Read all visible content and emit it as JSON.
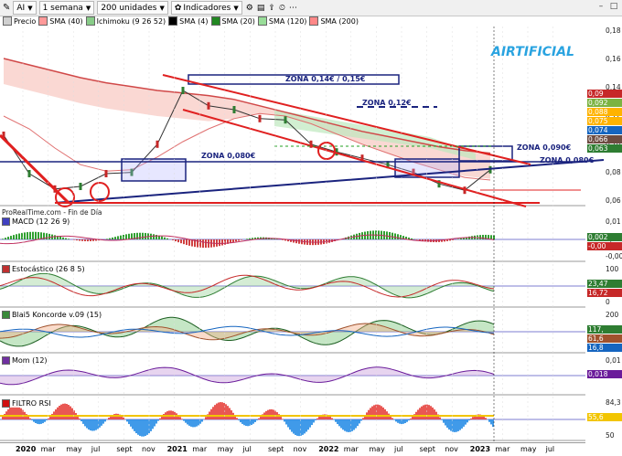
{
  "toolbar": {
    "symbol": "AI",
    "period": "1 semana",
    "units": "200 unidades",
    "indicators": "Indicadores"
  },
  "legend": [
    {
      "label": "Precio",
      "color": "#d0d0d0"
    },
    {
      "label": "SMA (40)",
      "color": "#ff9999"
    },
    {
      "label": "Ichimoku (9 26 52)",
      "color": "#88cc88"
    },
    {
      "label": "SMA (4)",
      "color": "#000000"
    },
    {
      "label": "SMA (20)",
      "color": "#228822"
    },
    {
      "label": "SMA (120)",
      "color": "#99dd99"
    },
    {
      "label": "SMA (200)",
      "color": "#ff8888"
    }
  ],
  "watermark": "AIRTIFICIAL",
  "source_note": "ProRealTime.com - Fin de Día",
  "annotations": {
    "zona_014": "ZONA 0,14€ / 0,15€",
    "zona_012": "ZONA 0,12€",
    "zona_0080_left": "ZONA 0,080€",
    "zona_0090": "ZONA 0,090€",
    "zona_0080_right": "ZONA 0,080€"
  },
  "price_axis": {
    "ticks": [
      "0,18",
      "0,16",
      "0,14",
      "0,12",
      "0,10",
      "0,08",
      "0,06"
    ],
    "labels": [
      "0,09",
      "0,092",
      "0,088",
      "0,075",
      "0,074",
      "0,066",
      "0,063"
    ]
  },
  "panes": {
    "macd": {
      "label": "MACD (12 26 9)",
      "ticks": [
        "0,01",
        "0,00",
        "-0,00"
      ],
      "labels": [
        "0,002",
        "-0,00"
      ]
    },
    "stoch": {
      "label": "Estocástico (26 8 5)",
      "ticks": [
        "100",
        "0"
      ],
      "labels": [
        "23,47",
        "16,72"
      ]
    },
    "koncorde": {
      "label": "Blai5 Koncorde v.09 (15)",
      "ticks": [
        "200",
        "0"
      ],
      "labels": [
        "117,",
        "61,6",
        "16,8"
      ]
    },
    "mom": {
      "label": "Mom (12)",
      "ticks": [
        "0,01"
      ],
      "labels": [
        "0,018"
      ]
    },
    "rsi": {
      "label": "FILTRO RSI",
      "ticks": [
        "84,3",
        "50"
      ],
      "labels": [
        "55,6"
      ]
    }
  },
  "time_axis": [
    "2020",
    "mar",
    "may",
    "jul",
    "sept",
    "nov",
    "2021",
    "mar",
    "may",
    "jul",
    "sept",
    "nov",
    "2022",
    "mar",
    "may",
    "jul",
    "sept",
    "nov",
    "2023",
    "mar",
    "may",
    "jul"
  ],
  "chart_data": {
    "type": "line",
    "title": "AI",
    "x": [
      "2020-01",
      "2020-03",
      "2020-05",
      "2020-07",
      "2020-09",
      "2020-11",
      "2021-01",
      "2021-02",
      "2021-03",
      "2021-05",
      "2021-07",
      "2021-09",
      "2021-11",
      "2022-01",
      "2022-03",
      "2022-05",
      "2022-07",
      "2022-09",
      "2022-11",
      "2023-01"
    ],
    "series": [
      {
        "name": "Precio",
        "values": [
          0.105,
          0.075,
          0.063,
          0.065,
          0.075,
          0.076,
          0.098,
          0.14,
          0.128,
          0.125,
          0.118,
          0.117,
          0.098,
          0.092,
          0.087,
          0.082,
          0.076,
          0.067,
          0.062,
          0.078
        ]
      },
      {
        "name": "SMA (40)",
        "values": [
          0.12,
          0.11,
          0.095,
          0.082,
          0.077,
          0.078,
          0.088,
          0.1,
          0.11,
          0.118,
          0.122,
          0.12,
          0.114,
          0.106,
          0.098,
          0.091,
          0.084,
          0.078,
          0.072,
          0.07
        ]
      },
      {
        "name": "SMA (200)",
        "values": [
          0.165,
          0.16,
          0.155,
          0.15,
          0.146,
          0.143,
          0.14,
          0.138,
          0.136,
          0.133,
          0.128,
          0.123,
          0.118,
          0.113,
          0.108,
          0.104,
          0.1,
          0.096,
          0.093,
          0.091
        ]
      }
    ],
    "ylim": [
      0.05,
      0.19
    ]
  }
}
